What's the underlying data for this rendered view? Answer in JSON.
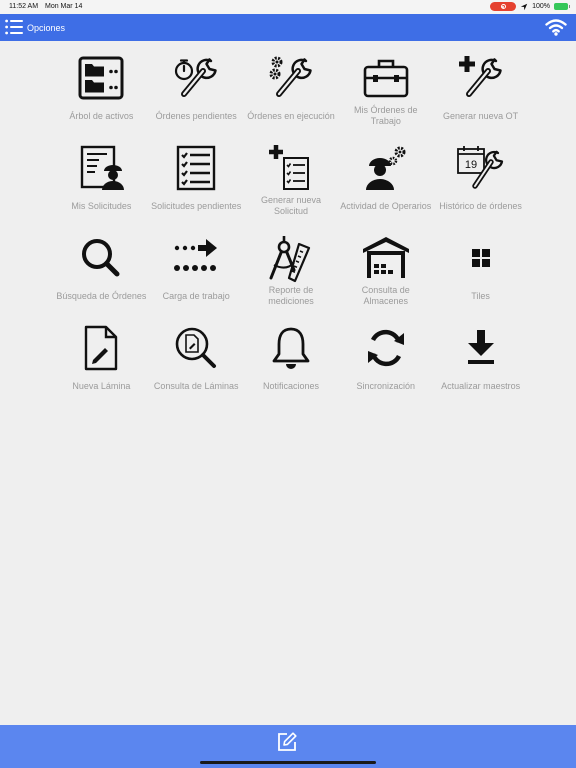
{
  "status_bar": {
    "time": "11:52 AM",
    "date": "Mon Mar 14",
    "battery": "100%",
    "colors": {
      "record": "#e5412f",
      "battery": "#35c759"
    }
  },
  "header": {
    "title": "Opciones",
    "menu_icon": "list-menu-icon",
    "status_icon": "wifi-icon",
    "color": "#3e6ee6"
  },
  "tiles": [
    {
      "label": "Árbol de activos",
      "icon": "asset-tree-icon"
    },
    {
      "label": "Órdenes pendientes",
      "icon": "stopwatch-wrench-icon"
    },
    {
      "label": "Órdenes en ejecución",
      "icon": "gears-wrench-icon"
    },
    {
      "label": "Mis Órdenes de Trabajo",
      "icon": "toolbox-icon"
    },
    {
      "label": "Generar nueva OT",
      "icon": "plus-wrench-icon"
    },
    {
      "label": "Mis Solicitudes",
      "icon": "worker-document-icon"
    },
    {
      "label": "Solicitudes pendientes",
      "icon": "checklist-icon"
    },
    {
      "label": "Generar nueva Solicitud",
      "icon": "plus-checklist-icon"
    },
    {
      "label": "Actividad de Operarios",
      "icon": "worker-gears-icon"
    },
    {
      "label": "Histórico de órdenes",
      "icon": "calendar-wrench-icon",
      "badge": "19"
    },
    {
      "label": "Búsqueda de Órdenes",
      "icon": "magnifier-icon"
    },
    {
      "label": "Carga de trabajo",
      "icon": "dots-arrow-icon"
    },
    {
      "label": "Reporte de mediciones",
      "icon": "compass-ruler-icon"
    },
    {
      "label": "Consulta de Almacenes",
      "icon": "warehouse-icon"
    },
    {
      "label": "Tiles",
      "icon": "tiles-icon"
    },
    {
      "label": "Nueva Lámina",
      "icon": "document-pencil-icon"
    },
    {
      "label": "Consulta de Láminas",
      "icon": "document-magnifier-icon"
    },
    {
      "label": "Notificaciones",
      "icon": "bell-icon"
    },
    {
      "label": "Sincronización",
      "icon": "sync-icon"
    },
    {
      "label": "Actualizar maestros",
      "icon": "download-icon"
    }
  ],
  "bottom_bar": {
    "action_icon": "edit-icon",
    "color": "#5b86ef"
  }
}
